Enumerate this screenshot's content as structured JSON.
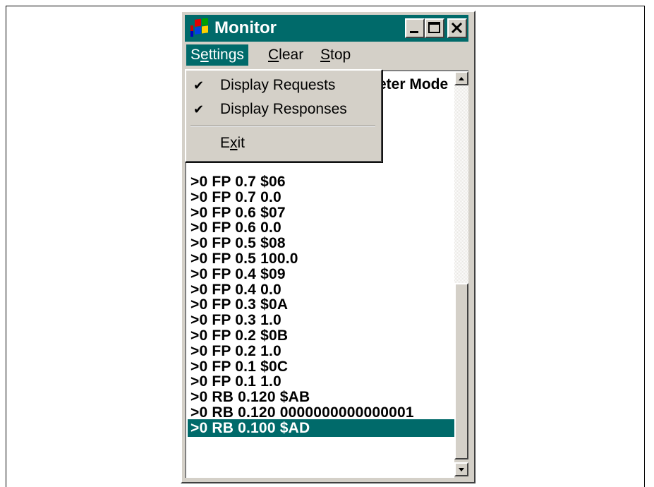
{
  "window": {
    "title": "Monitor",
    "buttons": [
      "minimize-icon",
      "maximize-icon",
      "close-icon"
    ]
  },
  "menu": {
    "settings": {
      "pre": "S",
      "mn": "e",
      "post": "ttings"
    },
    "clear": {
      "pre": "",
      "mn": "C",
      "post": "lear"
    },
    "stop": {
      "pre": "",
      "mn": "S",
      "post": "top"
    }
  },
  "dropdown": {
    "items": [
      {
        "label": "Display Requests",
        "checked": "✔"
      },
      {
        "label": "Display Responses",
        "checked": "✔"
      }
    ],
    "exit": {
      "pre": "E",
      "mn": "x",
      "post": "it"
    }
  },
  "header_partial": "eter Mode",
  "lines": [
    ">0 FP 0.7 $06",
    ">0 FP 0.7 0.0",
    ">0 FP 0.6 $07",
    ">0 FP 0.6 0.0",
    ">0 FP 0.5 $08",
    ">0 FP 0.5 100.0",
    ">0 FP 0.4 $09",
    ">0 FP 0.4 0.0",
    ">0 FP 0.3 $0A",
    ">0 FP 0.3 1.0",
    ">0 FP 0.2 $0B",
    ">0 FP 0.2 1.0",
    ">0 FP 0.1 $0C",
    ">0 FP 0.1 1.0",
    ">0 RB 0.120 $AB",
    ">0 RB 0.120 0000000000000001",
    ">0 RB 0.100 $AD"
  ],
  "selected_line": ">0 RB 0.100 $AD",
  "colors": {
    "titlebar": "#006a6a",
    "face": "#d4d0c8"
  }
}
